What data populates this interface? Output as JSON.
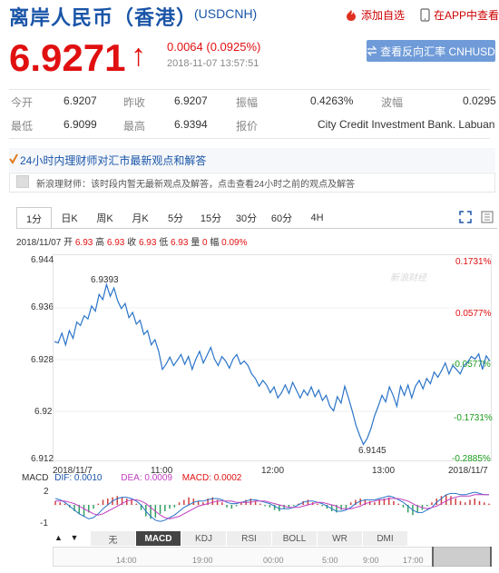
{
  "header": {
    "title": "离岸人民币（香港）",
    "code": "(USDCNH)",
    "add_favorite": "添加自选",
    "app_view": "在APP中查看"
  },
  "quote": {
    "price": "6.9271",
    "change": "0.0064 (0.0925%)",
    "time": "2018-11-07 13:57:51",
    "reverse_button": "查看反向汇率 CNHUSD"
  },
  "stats": {
    "open_label": "今开",
    "open": "6.9207",
    "prev_label": "昨收",
    "prev": "6.9207",
    "amp_label": "振幅",
    "amp": "0.4263%",
    "wave_label": "波幅",
    "wave": "0.0295",
    "low_label": "最低",
    "low": "6.9099",
    "high_label": "最高",
    "high": "6.9394",
    "quote_label": "报价",
    "quote_source": "City Credit Investment Bank. Labuan"
  },
  "expert": {
    "title": "24小时内理财师对汇市最新观点和解答",
    "message": "新浪理财师：该时段内暂无最新观点及解答，点击查看24小时之前的观点及解答"
  },
  "tabs": [
    "1分",
    "日K",
    "周K",
    "月K",
    "5分",
    "15分",
    "30分",
    "60分",
    "4H"
  ],
  "info": {
    "date": "2018/11/07",
    "open_label": "开",
    "open": "6.93",
    "high_label": "高",
    "high": "6.93",
    "close_label": "收",
    "close": "6.93",
    "low_label": "低",
    "low": "6.93",
    "vol_label": "量",
    "vol": "0",
    "amp_label": "幅",
    "amp": "0.09%"
  },
  "chart_data": {
    "type": "line",
    "y_ticks": [
      "6.944",
      "6.936",
      "6.928",
      "6.92",
      "6.912"
    ],
    "y_right_ticks": [
      "0.1731%",
      "0.0577%",
      "-0.0577%",
      "-0.1731%",
      "-0.2885%"
    ],
    "x_ticks": [
      "2018/11/7",
      "11:00",
      "12:00",
      "13:00",
      "2018/11/7"
    ],
    "ylim": [
      6.912,
      6.944
    ],
    "annotations": {
      "high": "6.9393",
      "low": "6.9145"
    },
    "watermark": "新浪财经",
    "series": [
      {
        "values": [
          6.9305,
          6.9303,
          6.9318,
          6.93,
          6.9322,
          6.931,
          6.9335,
          6.933,
          6.9345,
          6.934,
          6.936,
          6.9352,
          6.9378,
          6.937,
          6.9393,
          6.9375,
          6.9388,
          6.9368,
          6.9356,
          6.9364,
          6.9342,
          6.935,
          6.9332,
          6.9338,
          6.9316,
          6.9322,
          6.93,
          6.9308,
          6.929,
          6.9262,
          6.927,
          6.9281,
          6.9268,
          6.9276,
          6.9285,
          6.927,
          6.9282,
          6.9262,
          6.9278,
          6.929,
          6.9272,
          6.9284,
          6.9296,
          6.9278,
          6.9268,
          6.9282,
          6.9275,
          6.9264,
          6.9278,
          6.9285,
          6.927,
          6.9275,
          6.9268,
          6.9255,
          6.9248,
          6.9236,
          6.9245,
          6.9238,
          6.9226,
          6.9235,
          6.9218,
          6.9226,
          6.9238,
          6.9225,
          6.9242,
          6.923,
          6.9218,
          6.923,
          6.9222,
          6.9235,
          6.922,
          6.923,
          6.9214,
          6.9222,
          6.9205,
          6.9198,
          6.922,
          6.921,
          6.9236,
          6.9218,
          6.9198,
          6.9176,
          6.916,
          6.9146,
          6.9155,
          6.917,
          6.919,
          6.9205,
          6.9222,
          6.9212,
          6.9235,
          6.9222,
          6.9205,
          6.9236,
          6.9222,
          6.9238,
          6.9218,
          6.9236,
          6.9245,
          6.9232,
          6.9248,
          6.924,
          6.9258,
          6.925,
          6.926,
          6.9272,
          6.9255,
          6.9268,
          6.9262,
          6.9255,
          6.9268,
          6.9273,
          6.9282,
          6.9278,
          6.9286,
          6.9262,
          6.9283,
          6.9275
        ]
      }
    ]
  },
  "macd": {
    "label": "MACD",
    "dif": "DIF: 0.0010",
    "dea": "DEA: 0.0009",
    "macd": "MACD: 0.0002",
    "y_ticks": [
      "2",
      "-1"
    ],
    "hist": [
      0.3,
      0.2,
      0.1,
      -0.2,
      -0.5,
      -0.7,
      -0.9,
      -0.6,
      -0.3,
      0.1,
      0.4,
      0.5,
      0.6,
      0.7,
      0.6,
      0.5,
      0.4,
      0.1,
      -0.4,
      -0.9,
      -1.1,
      -1.0,
      -0.7,
      -0.5,
      -0.3,
      -0.2,
      0.2,
      0.4,
      0.6,
      0.5,
      0.3,
      0.2,
      0.5,
      0.6,
      0.4,
      0.2,
      -0.2,
      -0.3,
      -0.1,
      0.2,
      0.4,
      0.5,
      0.3,
      0.1,
      -0.1,
      -0.2,
      -0.4,
      -0.5,
      -0.3,
      -0.2,
      -0.1,
      0.1,
      0.3,
      0.4,
      0.2,
      0.1,
      -0.1,
      -0.3,
      -0.5,
      -0.6,
      -0.4,
      -0.3,
      0.2,
      0.4,
      0.5,
      0.4,
      0.3,
      0.2,
      0.4,
      0.5,
      0.6,
      0.3,
      0.1,
      -0.2,
      -0.6,
      -0.8,
      -0.6,
      -0.4,
      -0.1,
      0.2,
      0.5,
      0.7,
      0.8,
      0.7,
      0.5,
      0.3,
      0.2,
      0.4,
      0.5,
      0.3,
      0.2,
      0.1
    ],
    "dif_line": [
      0.5,
      0.4,
      0.2,
      -0.1,
      -0.4,
      -0.7,
      -0.9,
      -1.1,
      -1.0,
      -0.7,
      -0.3,
      0.0,
      0.3,
      0.5,
      0.6,
      0.6,
      0.5,
      0.3,
      0.0,
      -0.5,
      -0.9,
      -1.2,
      -1.3,
      -1.2,
      -1.0,
      -0.8,
      -0.5,
      -0.2,
      0.0,
      0.2,
      0.3,
      0.3,
      0.4,
      0.5,
      0.5,
      0.4,
      0.2,
      0.1,
      0.1,
      0.2,
      0.3,
      0.4,
      0.4,
      0.3,
      0.2,
      0.1,
      -0.1,
      -0.3,
      -0.3,
      -0.3,
      -0.2,
      0.0,
      0.2,
      0.3,
      0.3,
      0.2,
      0.1,
      -0.1,
      -0.3,
      -0.5,
      -0.5,
      -0.4,
      -0.2,
      0.1,
      0.3,
      0.4,
      0.4,
      0.4,
      0.5,
      0.6,
      0.7,
      0.6,
      0.4,
      0.2,
      -0.1,
      -0.4,
      -0.6,
      -0.6,
      -0.4,
      -0.2,
      0.2,
      0.5,
      0.8,
      0.9,
      0.9,
      0.8,
      0.8,
      0.9,
      1.0,
      0.9,
      0.8,
      0.8
    ],
    "dea_line": [
      0.3,
      0.3,
      0.3,
      0.2,
      0.1,
      -0.1,
      -0.3,
      -0.5,
      -0.7,
      -0.8,
      -0.7,
      -0.5,
      -0.3,
      -0.1,
      0.1,
      0.3,
      0.4,
      0.4,
      0.3,
      0.1,
      -0.2,
      -0.5,
      -0.8,
      -1.0,
      -1.1,
      -1.0,
      -0.9,
      -0.7,
      -0.5,
      -0.3,
      -0.1,
      0.0,
      0.1,
      0.2,
      0.3,
      0.3,
      0.3,
      0.3,
      0.2,
      0.2,
      0.2,
      0.2,
      0.3,
      0.3,
      0.3,
      0.2,
      0.1,
      0.0,
      -0.1,
      -0.2,
      -0.2,
      -0.2,
      -0.1,
      0.0,
      0.1,
      0.2,
      0.2,
      0.1,
      0.0,
      -0.1,
      -0.3,
      -0.3,
      -0.3,
      -0.2,
      -0.1,
      0.1,
      0.2,
      0.3,
      0.4,
      0.4,
      0.5,
      0.5,
      0.5,
      0.4,
      0.3,
      0.1,
      -0.1,
      -0.2,
      -0.3,
      -0.2,
      -0.1,
      0.1,
      0.3,
      0.5,
      0.6,
      0.7,
      0.7,
      0.7,
      0.8,
      0.8,
      0.8,
      0.8
    ]
  },
  "indicator_tabs": [
    "无",
    "MACD",
    "KDJ",
    "RSI",
    "BOLL",
    "WR",
    "DMI"
  ],
  "overview": {
    "labels": [
      "14:00",
      "19:00",
      "00:00",
      "5:00",
      "9:00",
      "17:00"
    ]
  }
}
